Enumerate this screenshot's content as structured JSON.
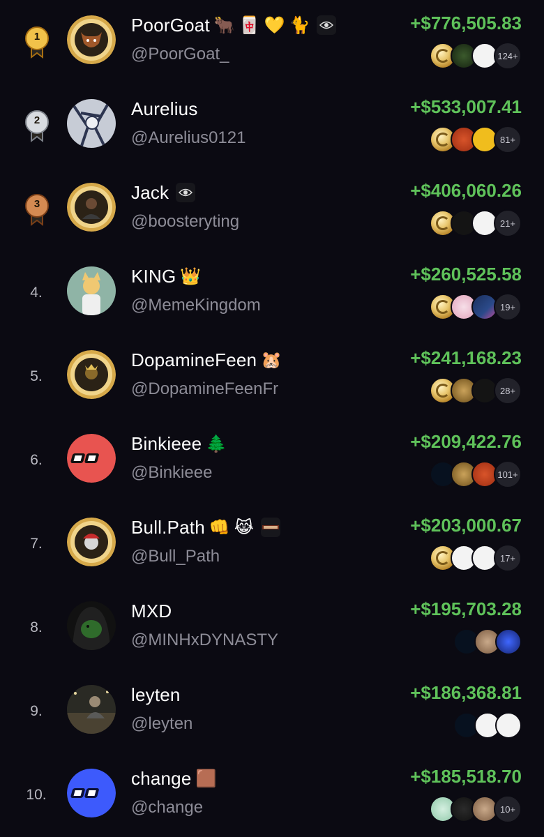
{
  "leaderboard": [
    {
      "rank": "1",
      "medal": "gold",
      "name": "PoorGoat",
      "emojis": [
        "🐂",
        "🀄",
        "💛",
        "🐈"
      ],
      "chip": "eye-emblem",
      "handle": "@PoorGoat_",
      "pnl": "+$776,505.83",
      "avatar": "gold-coin-bull",
      "tokens": [
        "gold-coin",
        "green-tok",
        "white-tok"
      ],
      "more": "124+"
    },
    {
      "rank": "2",
      "medal": "silver",
      "name": "Aurelius",
      "emojis": [],
      "chip": "",
      "handle": "@Aurelius0121",
      "pnl": "+$533,007.41",
      "avatar": "anime-sketch",
      "tokens": [
        "gold-coin",
        "red-tok",
        "yellow-tok"
      ],
      "more": "81+"
    },
    {
      "rank": "3",
      "medal": "bronze",
      "name": "Jack",
      "emojis": [],
      "chip": "eye-emblem",
      "handle": "@boosteryting",
      "pnl": "+$406,060.26",
      "avatar": "gold-coin-person",
      "tokens": [
        "gold-coin",
        "dark-tok",
        "white-tok"
      ],
      "more": "21+"
    },
    {
      "rank": "4.",
      "medal": "",
      "name": "KING",
      "emojis": [
        "👑"
      ],
      "chip": "",
      "handle": "@MemeKingdom",
      "pnl": "+$260,525.58",
      "avatar": "cat-character",
      "tokens": [
        "gold-coin",
        "pink-tok",
        "navy-tok"
      ],
      "more": "19+"
    },
    {
      "rank": "5.",
      "medal": "",
      "name": "DopamineFeen",
      "emojis": [
        "🐹"
      ],
      "chip": "",
      "handle": "@DopamineFeenFr",
      "pnl": "+$241,168.23",
      "avatar": "gold-coin-king",
      "tokens": [
        "gold-coin",
        "bronze-tok",
        "dark-tok"
      ],
      "more": "28+"
    },
    {
      "rank": "6.",
      "medal": "",
      "name": "Binkieee",
      "emojis": [
        "🌲"
      ],
      "chip": "",
      "handle": "@Binkieee",
      "pnl": "+$209,422.76",
      "avatar": "red-logo",
      "tokens": [
        "figure-tok",
        "bronze-tok",
        "red-tok"
      ],
      "more": "101+"
    },
    {
      "rank": "7.",
      "medal": "",
      "name": "Bull.Path",
      "emojis": [
        "👊",
        "😹"
      ],
      "chip": "dabal-chip",
      "handle": "@Bull_Path",
      "pnl": "+$203,000.67",
      "avatar": "gold-coin-cap",
      "tokens": [
        "gold-coin",
        "white-tok",
        "white-tok"
      ],
      "more": "17+"
    },
    {
      "rank": "8.",
      "medal": "",
      "name": "MXD",
      "emojis": [],
      "chip": "",
      "handle": "@MINHxDYNASTY",
      "pnl": "+$195,703.28",
      "avatar": "green-hood",
      "tokens": [
        "figure-tok",
        "cat-tok",
        "blue-tok"
      ],
      "more": ""
    },
    {
      "rank": "9.",
      "medal": "",
      "name": "leyten",
      "emojis": [],
      "chip": "",
      "handle": "@leyten",
      "pnl": "+$186,368.81",
      "avatar": "photo-dark",
      "tokens": [
        "figure-tok",
        "white-tok",
        "white-tok"
      ],
      "more": ""
    },
    {
      "rank": "10.",
      "medal": "",
      "name": "change",
      "emojis": [
        "🟫"
      ],
      "chip": "",
      "handle": "@change",
      "pnl": "+$185,518.70",
      "avatar": "blue-logo",
      "tokens": [
        "mint-tok",
        "orange-tok",
        "cat-tok"
      ],
      "more": "10+"
    }
  ],
  "colors": {
    "background": "#0b0a12",
    "profit": "#5fc25a",
    "handle": "#8d8c97",
    "gold": "#d9a330",
    "silver": "#b9bcc4",
    "bronze": "#b9733e"
  }
}
